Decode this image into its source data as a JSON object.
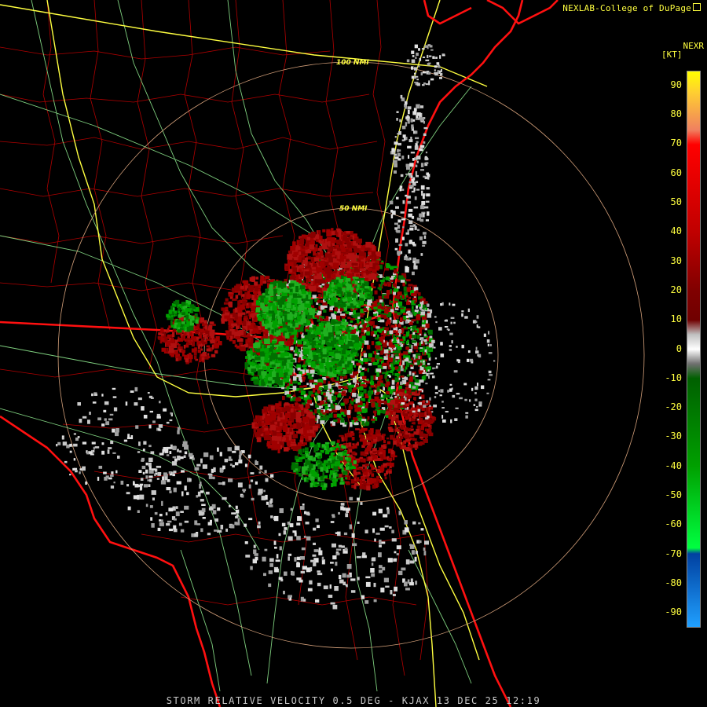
{
  "header": {
    "credit": "NEXLAB-College of DuPage",
    "credit_icon": "external-link-icon",
    "product": "NEXR",
    "units": "[KT]"
  },
  "range_rings": {
    "inner_label": "50 NMI",
    "outer_label": "100 NMI"
  },
  "colorbar": {
    "ticks": [
      "90",
      "80",
      "70",
      "60",
      "50",
      "40",
      "30",
      "20",
      "10",
      "0",
      "-10",
      "-20",
      "-30",
      "-40",
      "-50",
      "-60",
      "-70",
      "-80",
      "-90"
    ],
    "scale_min": -95,
    "scale_max": 95,
    "gradient_stops": [
      {
        "value": 95,
        "color": "#ffff00"
      },
      {
        "value": 88,
        "color": "#ffd030"
      },
      {
        "value": 75,
        "color": "#f08060"
      },
      {
        "value": 70,
        "color": "#ff0000"
      },
      {
        "value": 40,
        "color": "#c00000"
      },
      {
        "value": 20,
        "color": "#800000"
      },
      {
        "value": 10,
        "color": "#700000"
      },
      {
        "value": 5,
        "color": "#c0c0c0"
      },
      {
        "value": 0,
        "color": "#ffffff"
      },
      {
        "value": -5,
        "color": "#707070"
      },
      {
        "value": -10,
        "color": "#006000"
      },
      {
        "value": -40,
        "color": "#00a000"
      },
      {
        "value": -68,
        "color": "#00ff40"
      },
      {
        "value": -70,
        "color": "#0040a0"
      },
      {
        "value": -95,
        "color": "#20a0ff"
      }
    ]
  },
  "colors": {
    "background": "#000000",
    "state_boundary": "#ff1010",
    "county_boundary": "#c00000",
    "interstate": "#ffff40",
    "highway": "#90e090",
    "range_ring": "#e0a080",
    "text": "#ffff40",
    "inbound": "#00a000",
    "outbound": "#a00000",
    "near_zero": "#c8c8c8"
  },
  "footer": {
    "text": "STORM RELATIVE VELOCITY 0.5 DEG - KJAX 13 DEC 25 12:19"
  }
}
